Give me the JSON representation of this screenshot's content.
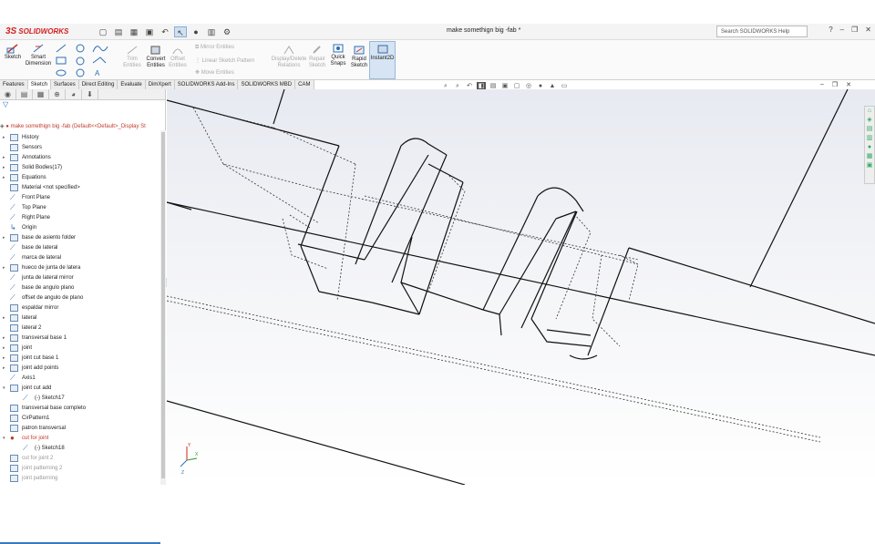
{
  "app": {
    "brand": "SOLIDWORKS",
    "doc_title": "make somethign big -fab *",
    "search_placeholder": "Search SOLIDWORKS Help"
  },
  "ribbon": {
    "sketch": "Sketch",
    "smart_dimension": "Smart Dimension",
    "trim_entities": "Trim Entities",
    "convert_entities": "Convert Entities",
    "offset_entities": "Offset Entities",
    "mirror_entities": "Mirror Entities",
    "linear_sketch_pattern": "Linear Sketch Pattern",
    "move_entities": "Move Entities",
    "display_delete_relations": "Display/Delete Relations",
    "repair_sketch": "Repair Sketch",
    "quick_snaps": "Quick Snaps",
    "rapid_sketch": "Rapid Sketch",
    "instant2d": "Instant2D"
  },
  "tabs": [
    "Features",
    "Sketch",
    "Surfaces",
    "Direct Editing",
    "Evaluate",
    "DimXpert",
    "SOLIDWORKS Add-Ins",
    "SOLIDWORKS MBD",
    "CAM"
  ],
  "tree_root": "make somethign big -fab  (Default<<Default>_Display St",
  "tree": [
    {
      "label": "History",
      "icon": "folder-icon",
      "expander": true
    },
    {
      "label": "Sensors",
      "icon": "sensor-icon",
      "expander": false
    },
    {
      "label": "Annotations",
      "icon": "annotation-icon",
      "expander": true
    },
    {
      "label": "Solid Bodies(17)",
      "icon": "folder-icon",
      "expander": true
    },
    {
      "label": "Equations",
      "icon": "equation-icon",
      "expander": true
    },
    {
      "label": "Material <not specified>",
      "icon": "material-icon",
      "expander": false
    },
    {
      "label": "Front Plane",
      "icon": "plane-icon",
      "expander": false
    },
    {
      "label": "Top Plane",
      "icon": "plane-icon",
      "expander": false
    },
    {
      "label": "Right Plane",
      "icon": "plane-icon",
      "expander": false
    },
    {
      "label": "Origin",
      "icon": "origin-icon",
      "expander": false
    },
    {
      "label": "base de asiento folder",
      "icon": "folder-icon",
      "expander": true
    },
    {
      "label": "base de lateral",
      "icon": "sketch-icon",
      "expander": false
    },
    {
      "label": "marca de lateral",
      "icon": "sketch-icon",
      "expander": false
    },
    {
      "label": "hueco de junta de latera",
      "icon": "cut-icon",
      "expander": true
    },
    {
      "label": "junta de lateral mirror",
      "icon": "sketch-icon",
      "expander": false
    },
    {
      "label": "base de angulo plano",
      "icon": "sketch-icon",
      "expander": false
    },
    {
      "label": "offset de angulo de plano",
      "icon": "sketch-icon",
      "expander": false
    },
    {
      "label": "espaldar mirror",
      "icon": "mirror-icon",
      "expander": false
    },
    {
      "label": "lateral",
      "icon": "boss-icon",
      "expander": true
    },
    {
      "label": "lateral 2",
      "icon": "boss-icon",
      "expander": false
    },
    {
      "label": "transversal base 1",
      "icon": "boss-icon",
      "expander": true
    },
    {
      "label": "joint",
      "icon": "cut-icon",
      "expander": true
    },
    {
      "label": "joint cut base 1",
      "icon": "cut-icon",
      "expander": true
    },
    {
      "label": "joint add points",
      "icon": "cut-icon",
      "expander": true
    },
    {
      "label": "Axis1",
      "icon": "axis-icon",
      "expander": false
    },
    {
      "label": "joint cut add",
      "icon": "cut-icon",
      "expander": true,
      "open": true
    },
    {
      "label": "(-) Sketch17",
      "icon": "sketch-icon",
      "indent": true
    },
    {
      "label": "transversal base completo",
      "icon": "boss-icon",
      "expander": false
    },
    {
      "label": "CirPattern1",
      "icon": "pattern-icon",
      "expander": false
    },
    {
      "label": "patron transversal",
      "icon": "pattern-icon",
      "expander": false
    },
    {
      "label": "cut for joint",
      "icon": "error-icon",
      "expander": true,
      "open": true,
      "state": "red"
    },
    {
      "label": "(-) Sketch18",
      "icon": "sketch-icon",
      "indent": true
    },
    {
      "label": "cut for joint 2",
      "icon": "cut-icon",
      "expander": false,
      "state": "grey"
    },
    {
      "label": "joint patterning 2",
      "icon": "pattern-icon",
      "expander": false,
      "state": "grey"
    },
    {
      "label": "joint patterning",
      "icon": "pattern-icon",
      "expander": false,
      "state": "grey"
    }
  ]
}
